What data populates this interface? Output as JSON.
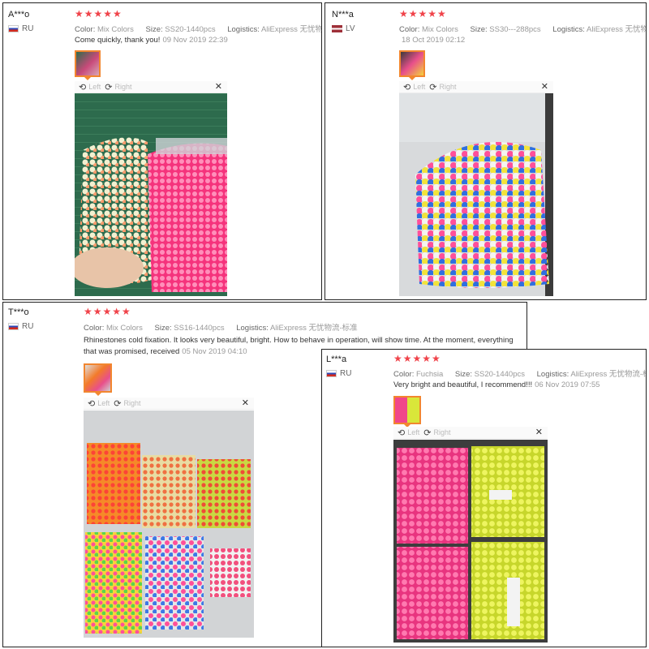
{
  "viewer": {
    "left_label": "Left",
    "right_label": "Right",
    "close_glyph": "✕"
  },
  "stars": "★★★★★",
  "labels": {
    "color": "Color:",
    "size": "Size:",
    "logistics": "Logistics:"
  },
  "reviews": [
    {
      "user": "A***o",
      "country": "RU",
      "color": "Mix Colors",
      "size": "SS20-1440pcs",
      "logistics": "AliExpress 无忧物流-标准",
      "text": "Come quickly, thank you!",
      "date": "09 Nov 2019 22:39"
    },
    {
      "user": "N***a",
      "country": "LV",
      "color": "Mix Colors",
      "size": "SS30---288pcs",
      "logistics": "AliExpress 无忧物流-标准",
      "text": "",
      "date": "18 Oct 2019 02:12"
    },
    {
      "user": "T***o",
      "country": "RU",
      "color": "Mix Colors",
      "size": "SS16-1440pcs",
      "logistics": "AliExpress 无忧物流-标准",
      "text": "Rhinestones cold fixation. It looks very beautiful, bright. How to behave in operation, will show time. At the moment, everything that was promised, received",
      "date": "05 Nov 2019 04:10"
    },
    {
      "user": "L***a",
      "country": "RU",
      "color": "Fuchsia",
      "size": "SS20-1440pcs",
      "logistics": "AliExpress 无忧物流-标准",
      "text": "Very bright and beautiful, I recommend!!!",
      "date": "06 Nov 2019 07:55"
    }
  ]
}
